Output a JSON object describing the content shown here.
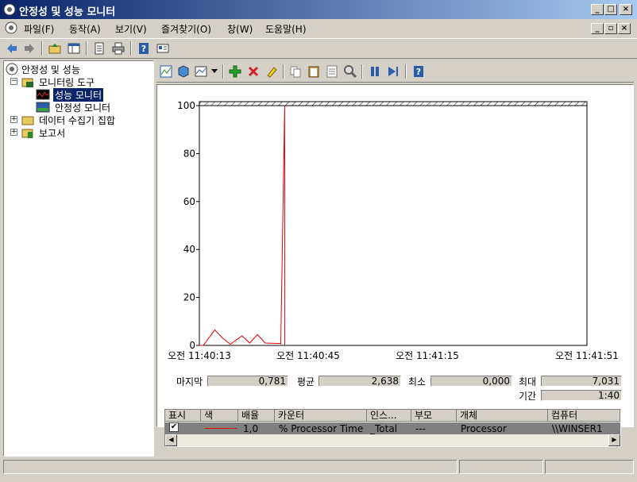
{
  "window": {
    "title": "안정성 및 성능 모니터",
    "buttons": {
      "minimize": "_",
      "maximize": "□",
      "close": "×"
    },
    "mdi_buttons": {
      "minimize": "_",
      "restore": "▫",
      "close": "×"
    }
  },
  "menu": {
    "items": [
      "파일(F)",
      "동작(A)",
      "보기(V)",
      "즐겨찾기(O)",
      "창(W)",
      "도움말(H)"
    ]
  },
  "tree": {
    "root": "안정성 및 성능",
    "items": [
      {
        "label": "모니터링 도구",
        "expander": "−"
      },
      {
        "label": "성능 모니터",
        "selected": true
      },
      {
        "label": "안정성 모니터"
      },
      {
        "label": "데이터 수집기 집합",
        "expander": "+"
      },
      {
        "label": "보고서",
        "expander": "+"
      }
    ]
  },
  "graph": {
    "y_ticks": [
      "0",
      "20",
      "40",
      "60",
      "80",
      "100"
    ],
    "x_labels": [
      "오전 11:40:13",
      "오전 11:40:45",
      "오전 11:41:15",
      "오전 11:41:51"
    ],
    "ylim": [
      0,
      100
    ],
    "line_color": "#e00000",
    "series_values": [
      0,
      0,
      6.5,
      3,
      0.5,
      4,
      1,
      4.5,
      1,
      0.8,
      100
    ],
    "series_indices": [
      0,
      1,
      4,
      6,
      8,
      11,
      13,
      15,
      17,
      21,
      22
    ]
  },
  "stats": {
    "last_label": "마지막",
    "last_value": "0,781",
    "avg_label": "평균",
    "avg_value": "2,638",
    "min_label": "최소",
    "min_value": "0,000",
    "max_label": "최대",
    "max_value": "7,031",
    "duration_label": "기간",
    "duration_value": "1:40"
  },
  "counters": {
    "headers": [
      "표시",
      "색",
      "배율",
      "카운터",
      "인스...",
      "부모",
      "개체",
      "컴퓨터"
    ],
    "rows": [
      {
        "checked": "✔",
        "color": "#e00000",
        "scale": "1,0",
        "counter": "% Processor Time",
        "instance": "_Total",
        "parent": "---",
        "object": "Processor",
        "computer": "\\\\WINSER1"
      }
    ]
  },
  "status": {
    "text": ""
  }
}
